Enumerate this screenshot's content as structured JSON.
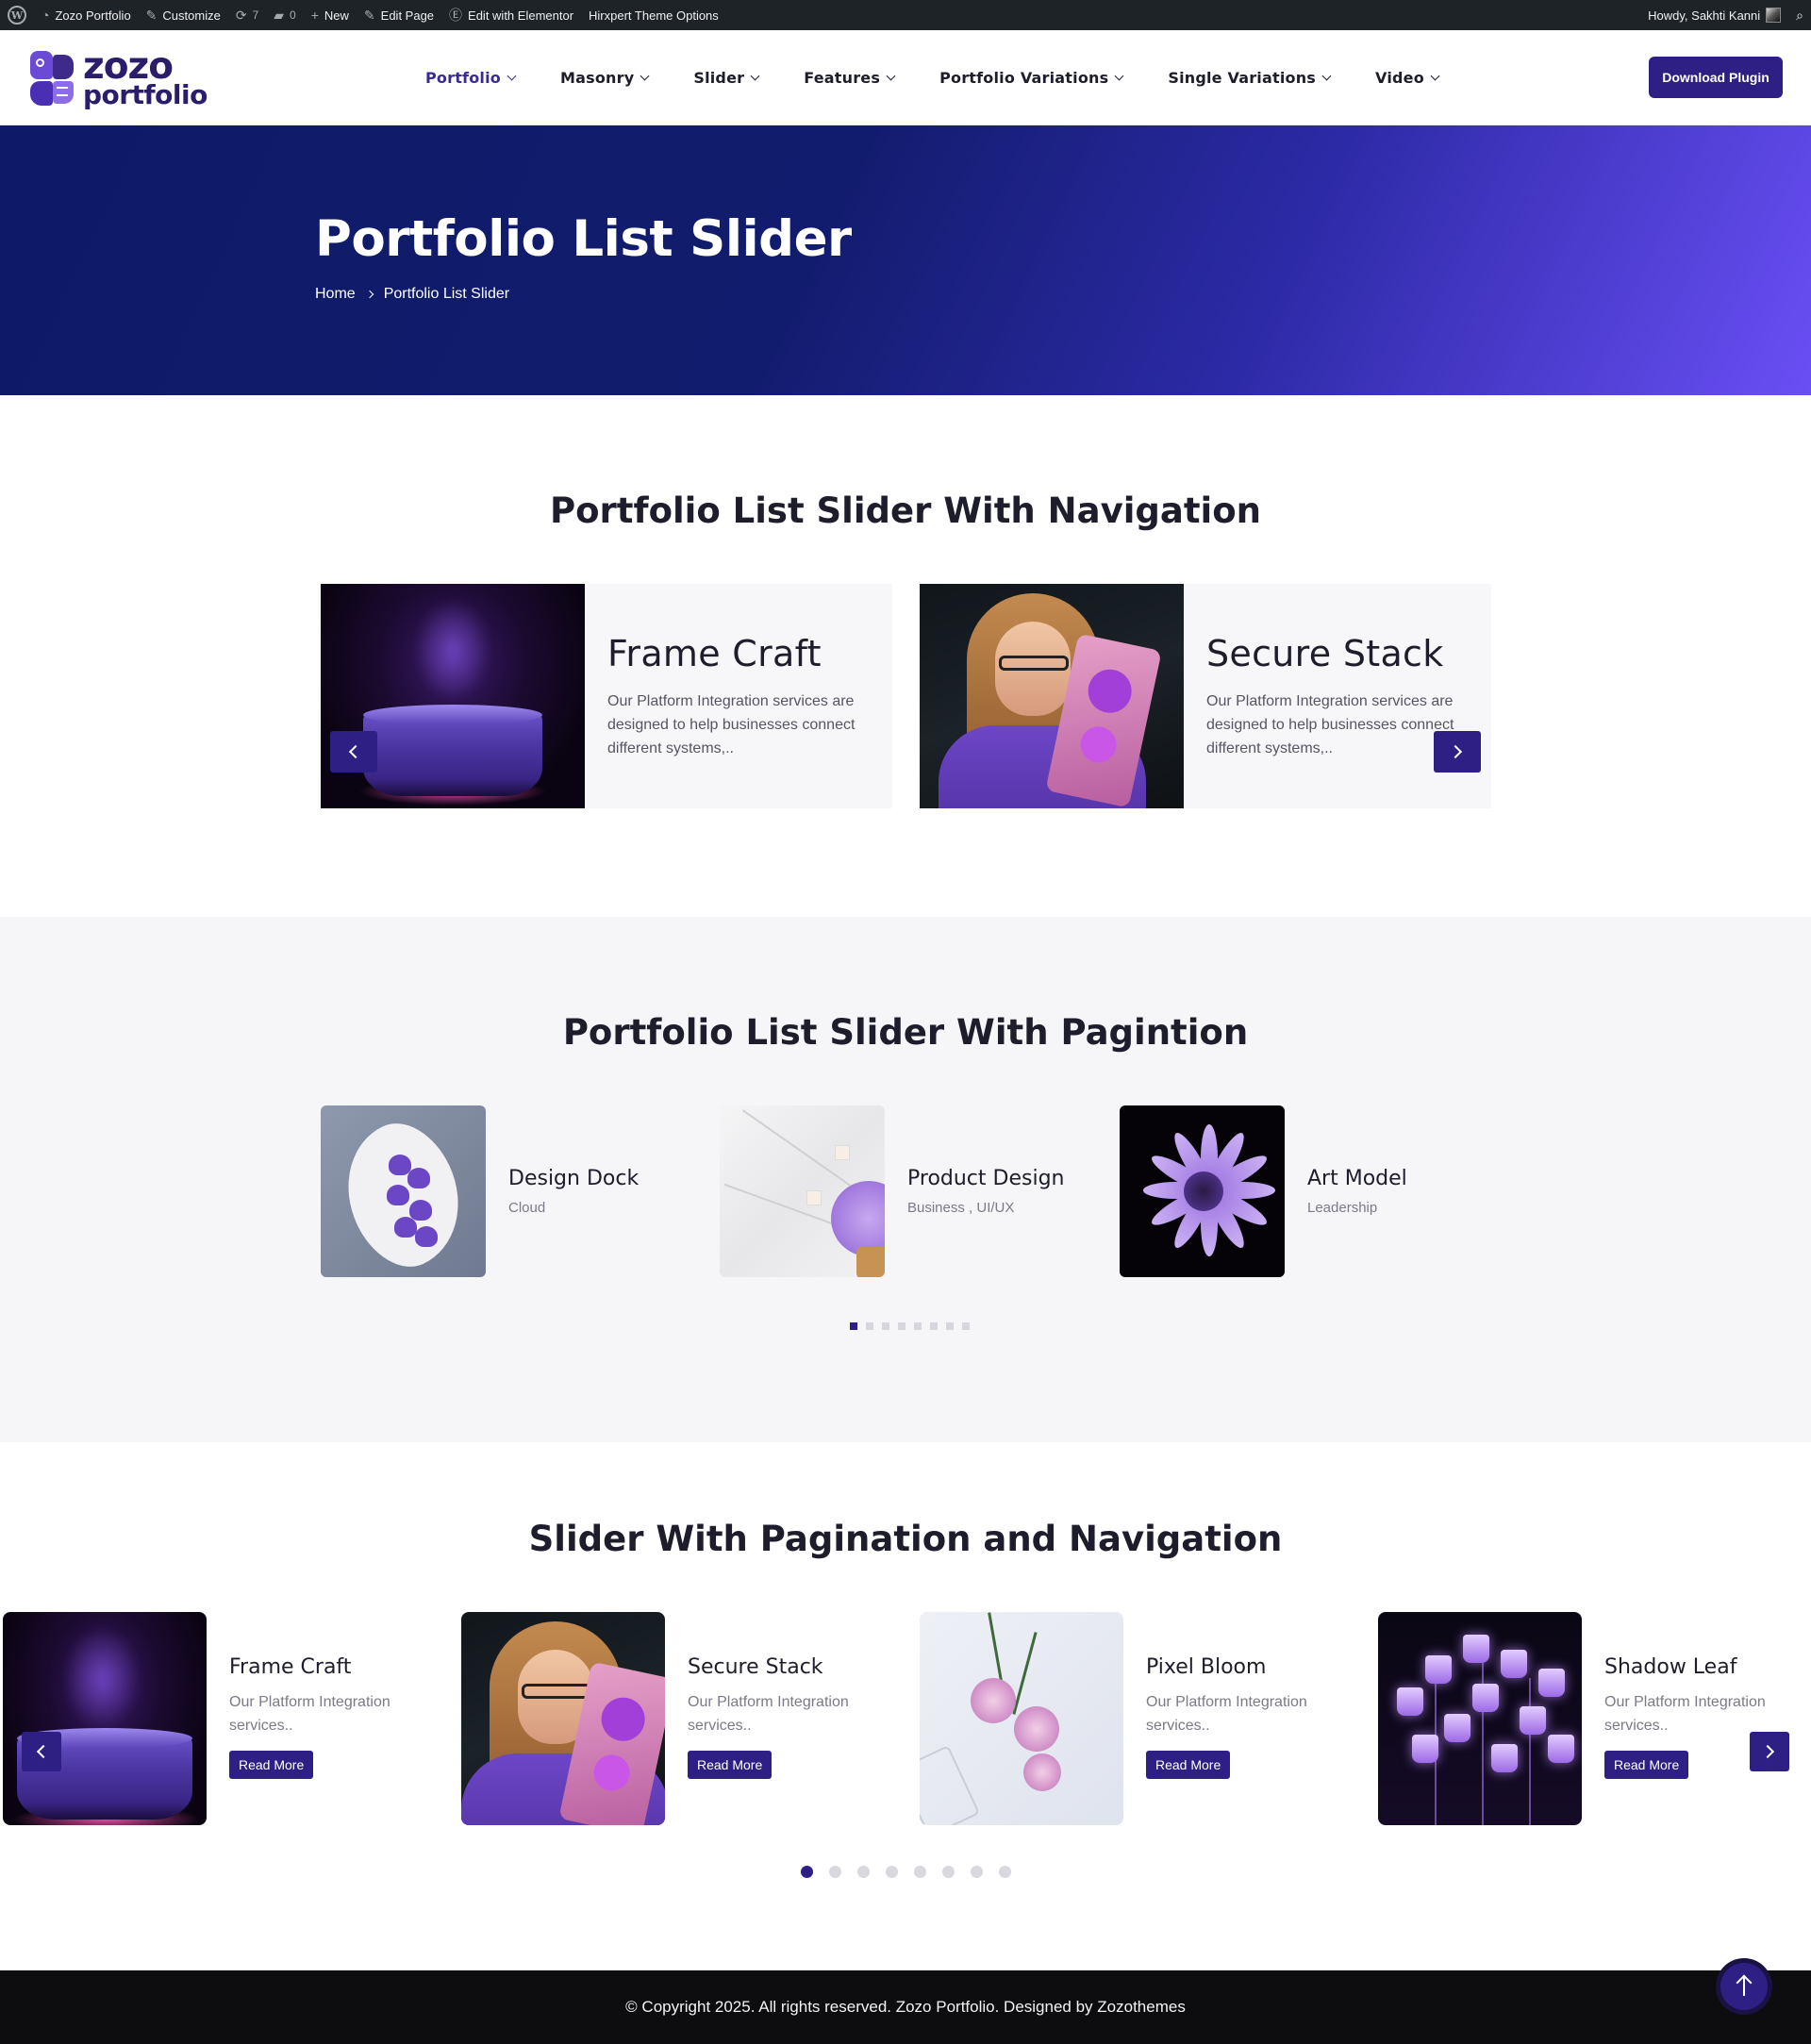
{
  "adminbar": {
    "site": "Zozo Portfolio",
    "customize": "Customize",
    "updates": "7",
    "comments": "0",
    "new": "New",
    "edit_page": "Edit Page",
    "edit_elementor": "Edit with Elementor",
    "theme_options": "Hirxpert Theme Options",
    "howdy": "Howdy, Sakhti Kanni"
  },
  "header": {
    "logo_line1": "zozo",
    "logo_line2": "portfolio",
    "nav": [
      {
        "label": "Portfolio",
        "active": true
      },
      {
        "label": "Masonry"
      },
      {
        "label": "Slider"
      },
      {
        "label": "Features"
      },
      {
        "label": "Portfolio Variations"
      },
      {
        "label": "Single Variations"
      },
      {
        "label": "Video"
      }
    ],
    "download_label": "Download Plugin"
  },
  "hero": {
    "title": "Portfolio List Slider",
    "breadcrumb_home": "Home",
    "breadcrumb_current": "Portfolio List Slider"
  },
  "section_nav": {
    "title": "Portfolio List Slider With Navigation",
    "cards": [
      {
        "title": "Frame Craft",
        "desc": "Our Platform Integration services are designed to help businesses connect different systems,.."
      },
      {
        "title": "Secure Stack",
        "desc": "Our Platform Integration services are designed to help businesses connect different systems,.."
      }
    ]
  },
  "section_pag": {
    "title": "Portfolio List Slider With Pagintion",
    "items": [
      {
        "title": "Design Dock",
        "category": "Cloud"
      },
      {
        "title": "Product Design",
        "category": "Business , UI/UX"
      },
      {
        "title": "Art Model",
        "category": "Leadership"
      }
    ],
    "active_page": 1,
    "page_count": 8
  },
  "section_both": {
    "title": "Slider With Pagination and Navigation",
    "cards": [
      {
        "title": "Frame Craft",
        "desc": "Our Platform Integration services..",
        "button": "Read More"
      },
      {
        "title": "Secure Stack",
        "desc": "Our Platform Integration services..",
        "button": "Read More"
      },
      {
        "title": "Pixel Bloom",
        "desc": "Our Platform Integration services..",
        "button": "Read More"
      },
      {
        "title": "Shadow Leaf",
        "desc": "Our Platform Integration services..",
        "button": "Read More"
      }
    ],
    "active_page": 1,
    "page_count": 8
  },
  "footer": {
    "copyright": "© Copyright 2025. All rights reserved. Zozo Portfolio. Designed by Zozothemes"
  },
  "colors": {
    "accent": "#2e1f84",
    "hero_start": "#0e1a66",
    "hero_end": "#6a4ff5"
  }
}
